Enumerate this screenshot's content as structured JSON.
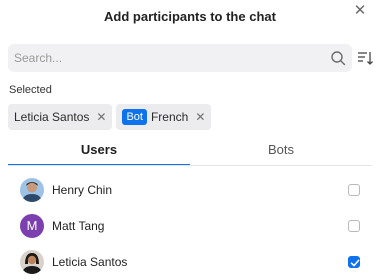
{
  "dialog": {
    "title": "Add participants to the chat",
    "close_icon": "close-icon"
  },
  "search": {
    "placeholder": "Search...",
    "value": "",
    "icon": "search-icon",
    "sort_icon": "sort-icon"
  },
  "selected": {
    "label": "Selected",
    "chips": [
      {
        "name": "Leticia Santos",
        "remove_icon": "close-icon"
      },
      {
        "badge": "Bot",
        "name": "French",
        "remove_icon": "close-icon"
      }
    ]
  },
  "tabs": [
    {
      "label": "Users",
      "active": true
    },
    {
      "label": "Bots",
      "active": false
    }
  ],
  "users": [
    {
      "name": "Henry Chin",
      "avatar": "photo",
      "checked": false
    },
    {
      "name": "Matt Tang",
      "avatar_letter": "M",
      "checked": false
    },
    {
      "name": "Leticia Santos",
      "avatar": "photo",
      "checked": true
    }
  ],
  "colors": {
    "accent": "#0e72ed",
    "chip_bg": "#ececef",
    "search_bg": "#f1f1f3",
    "avatar_m": "#7b3fb0"
  }
}
